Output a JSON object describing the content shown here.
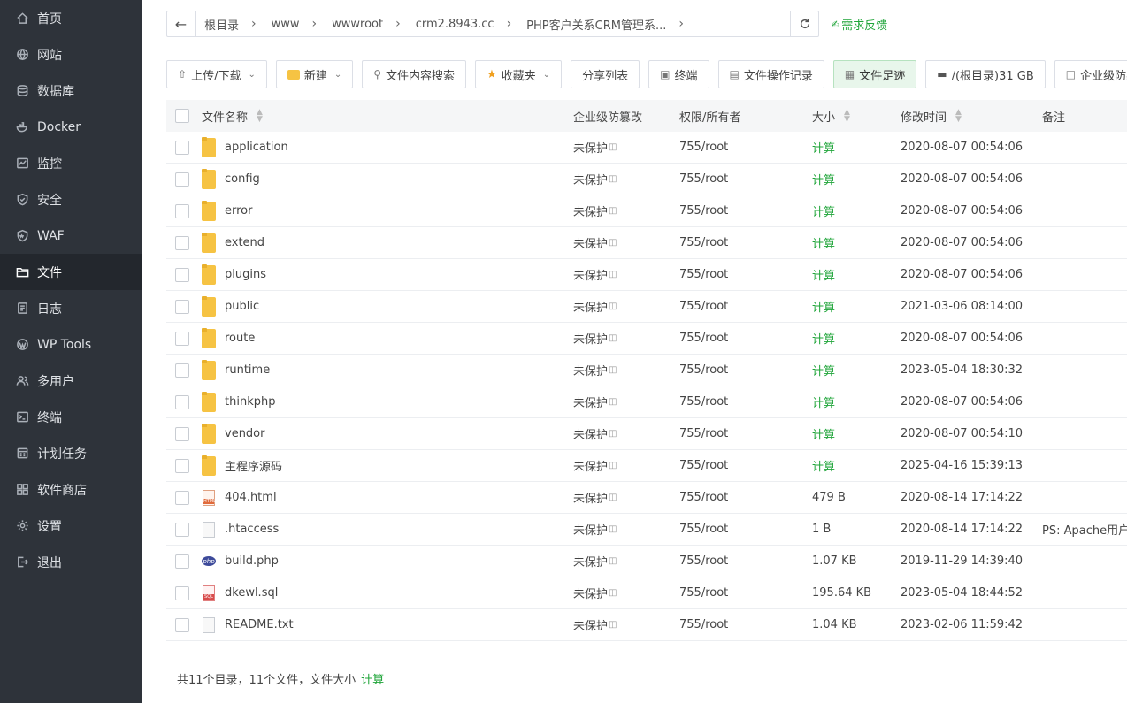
{
  "sidebar": {
    "items": [
      {
        "label": "首页",
        "icon": "home-icon"
      },
      {
        "label": "网站",
        "icon": "globe-icon"
      },
      {
        "label": "数据库",
        "icon": "database-icon"
      },
      {
        "label": "Docker",
        "icon": "docker-icon"
      },
      {
        "label": "监控",
        "icon": "monitor-icon"
      },
      {
        "label": "安全",
        "icon": "shield-icon"
      },
      {
        "label": "WAF",
        "icon": "waf-icon"
      },
      {
        "label": "文件",
        "icon": "folder-icon"
      },
      {
        "label": "日志",
        "icon": "log-icon"
      },
      {
        "label": "WP Tools",
        "icon": "wordpress-icon"
      },
      {
        "label": "多用户",
        "icon": "users-icon"
      },
      {
        "label": "终端",
        "icon": "terminal-icon"
      },
      {
        "label": "计划任务",
        "icon": "calendar-icon"
      },
      {
        "label": "软件商店",
        "icon": "apps-icon"
      },
      {
        "label": "设置",
        "icon": "gear-icon"
      },
      {
        "label": "退出",
        "icon": "logout-icon"
      }
    ],
    "active_index": 7
  },
  "address": {
    "crumbs": [
      "根目录",
      "www",
      "wwwroot",
      "crm2.8943.cc",
      "PHP客户关系CRM管理系..."
    ],
    "feedback": "需求反馈"
  },
  "toolbar": {
    "upload": "上传/下载",
    "new": "新建",
    "search": "文件内容搜索",
    "favorites": "收藏夹",
    "share": "分享列表",
    "terminal": "终端",
    "oplog": "文件操作记录",
    "footprint": "文件足迹",
    "disk": "/(根目录)31 GB",
    "tamper": "企业级防篡改"
  },
  "table": {
    "headers": {
      "name": "文件名称",
      "protect": "企业级防篡改",
      "perm": "权限/所有者",
      "size": "大小",
      "mtime": "修改时间",
      "note": "备注"
    },
    "rows": [
      {
        "name": "application",
        "type": "folder",
        "protect": "未保护",
        "perm": "755/root",
        "size": "计算",
        "mtime": "2020-08-07 00:54:06",
        "note": ""
      },
      {
        "name": "config",
        "type": "folder",
        "protect": "未保护",
        "perm": "755/root",
        "size": "计算",
        "mtime": "2020-08-07 00:54:06",
        "note": ""
      },
      {
        "name": "error",
        "type": "folder",
        "protect": "未保护",
        "perm": "755/root",
        "size": "计算",
        "mtime": "2020-08-07 00:54:06",
        "note": ""
      },
      {
        "name": "extend",
        "type": "folder",
        "protect": "未保护",
        "perm": "755/root",
        "size": "计算",
        "mtime": "2020-08-07 00:54:06",
        "note": ""
      },
      {
        "name": "plugins",
        "type": "folder",
        "protect": "未保护",
        "perm": "755/root",
        "size": "计算",
        "mtime": "2020-08-07 00:54:06",
        "note": ""
      },
      {
        "name": "public",
        "type": "folder",
        "protect": "未保护",
        "perm": "755/root",
        "size": "计算",
        "mtime": "2021-03-06 08:14:00",
        "note": ""
      },
      {
        "name": "route",
        "type": "folder",
        "protect": "未保护",
        "perm": "755/root",
        "size": "计算",
        "mtime": "2020-08-07 00:54:06",
        "note": ""
      },
      {
        "name": "runtime",
        "type": "folder",
        "protect": "未保护",
        "perm": "755/root",
        "size": "计算",
        "mtime": "2023-05-04 18:30:32",
        "note": ""
      },
      {
        "name": "thinkphp",
        "type": "folder",
        "protect": "未保护",
        "perm": "755/root",
        "size": "计算",
        "mtime": "2020-08-07 00:54:06",
        "note": ""
      },
      {
        "name": "vendor",
        "type": "folder",
        "protect": "未保护",
        "perm": "755/root",
        "size": "计算",
        "mtime": "2020-08-07 00:54:10",
        "note": ""
      },
      {
        "name": "主程序源码",
        "type": "folder",
        "protect": "未保护",
        "perm": "755/root",
        "size": "计算",
        "mtime": "2025-04-16 15:39:13",
        "note": ""
      },
      {
        "name": "404.html",
        "type": "html",
        "protect": "未保护",
        "perm": "755/root",
        "size": "479 B",
        "mtime": "2020-08-14 17:14:22",
        "note": ""
      },
      {
        "name": ".htaccess",
        "type": "doc",
        "protect": "未保护",
        "perm": "755/root",
        "size": "1 B",
        "mtime": "2020-08-14 17:14:22",
        "note": "PS: Apache用户配"
      },
      {
        "name": "build.php",
        "type": "php",
        "protect": "未保护",
        "perm": "755/root",
        "size": "1.07 KB",
        "mtime": "2019-11-29 14:39:40",
        "note": ""
      },
      {
        "name": "dkewl.sql",
        "type": "sql",
        "protect": "未保护",
        "perm": "755/root",
        "size": "195.64 KB",
        "mtime": "2023-05-04 18:44:52",
        "note": ""
      },
      {
        "name": "README.txt",
        "type": "doc",
        "protect": "未保护",
        "perm": "755/root",
        "size": "1.04 KB",
        "mtime": "2023-02-06 11:59:42",
        "note": ""
      }
    ]
  },
  "footer": {
    "summary": "共11个目录，11个文件，文件大小",
    "calc": "计算"
  }
}
